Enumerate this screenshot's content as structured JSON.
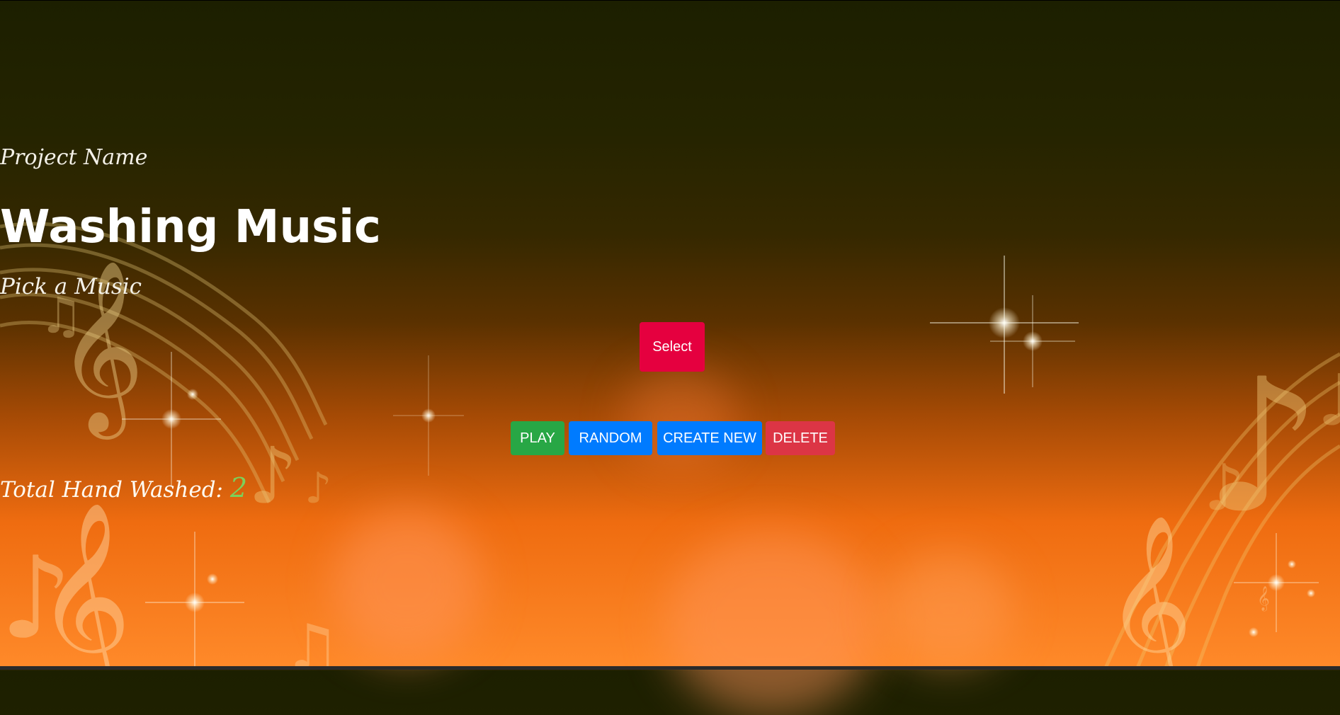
{
  "page": {
    "project_label": "Project Name",
    "title": "Washing Music",
    "subtitle": "Pick a Music"
  },
  "controls": {
    "select_label": "Select",
    "play_label": "PLAY",
    "random_label": "RANDOM",
    "create_label": "CREATE NEW",
    "delete_label": "DELETE"
  },
  "stats": {
    "total_label": "Total Hand Washed:",
    "total_count": "2"
  },
  "colors": {
    "select": "#e5003f",
    "play": "#28a745",
    "random": "#007bff",
    "create": "#007bff",
    "delete": "#dc3545",
    "count": "#7cd05a"
  },
  "icons": [
    "treble-clef-icon",
    "music-note-icon",
    "sparkle-icon",
    "music-staff-icon"
  ]
}
